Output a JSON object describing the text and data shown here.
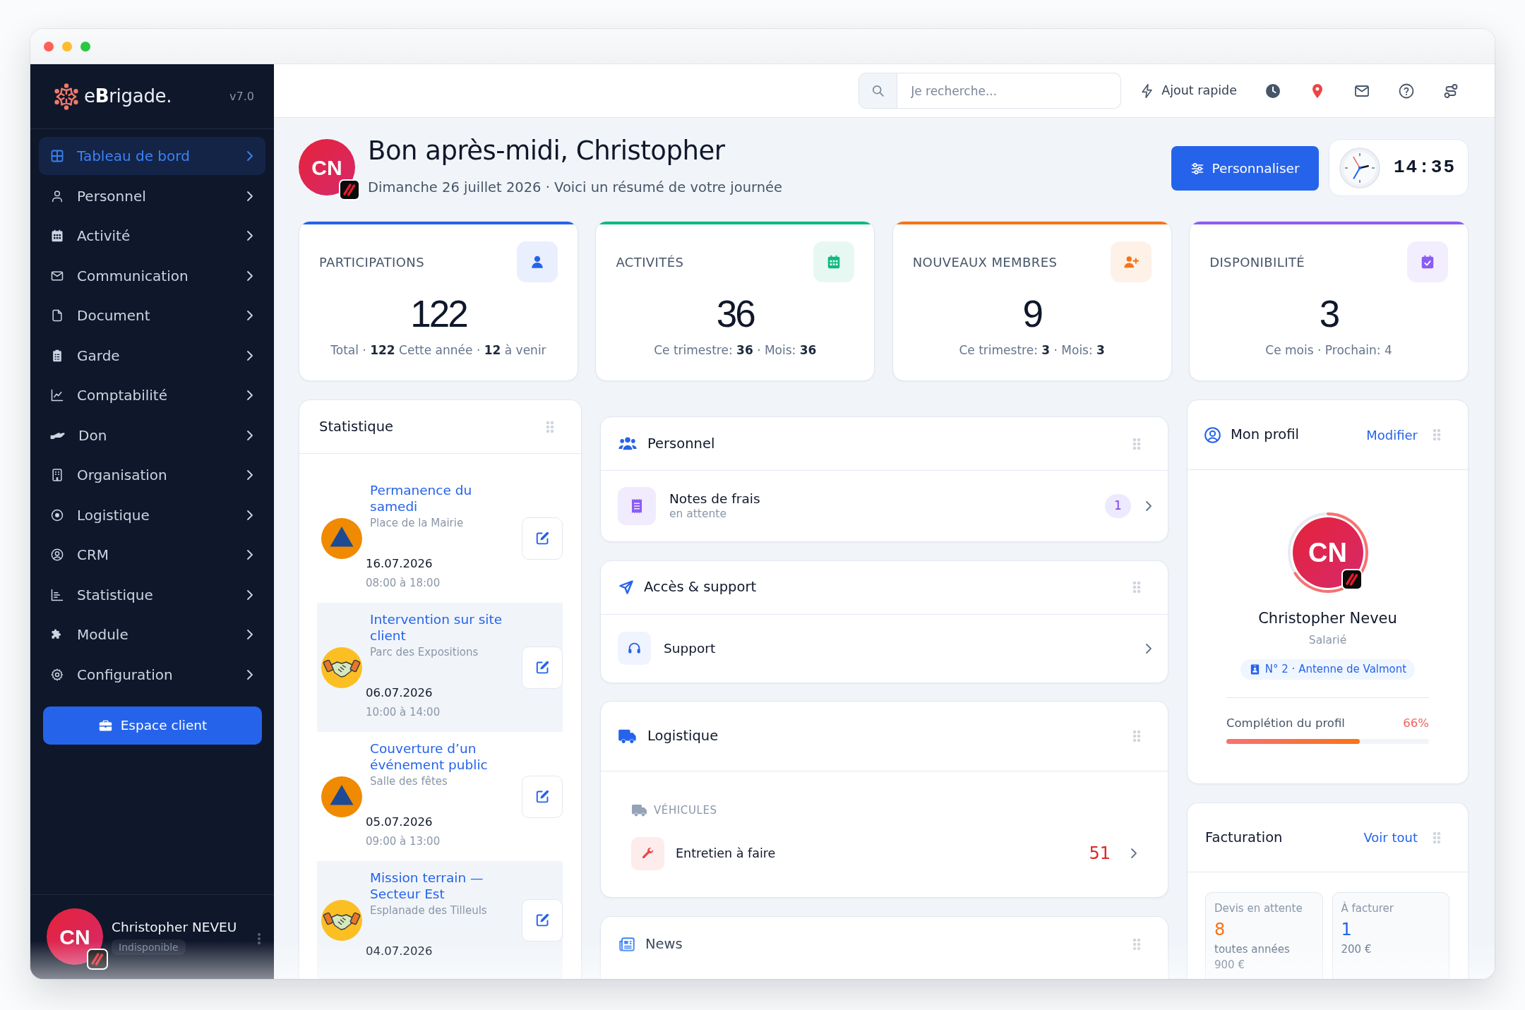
{
  "sidebar": {
    "logo": "e**B**rigade.",
    "version": "v7.0",
    "items": [
      {
        "label": "Tableau de bord",
        "selected": true
      },
      {
        "label": "Personnel",
        "selected": false
      },
      {
        "label": "Activité",
        "selected": false
      },
      {
        "label": "Communication",
        "selected": false
      },
      {
        "label": "Document",
        "selected": false
      },
      {
        "label": "Garde",
        "selected": false
      },
      {
        "label": "Comptabilité",
        "selected": false
      },
      {
        "label": "Don",
        "selected": false
      },
      {
        "label": "Organisation",
        "selected": false
      },
      {
        "label": "Logistique",
        "selected": false
      },
      {
        "label": "CRM",
        "selected": false
      },
      {
        "label": "Statistique",
        "selected": false
      },
      {
        "label": "Module",
        "selected": false
      },
      {
        "label": "Configuration",
        "selected": false
      }
    ],
    "client_button": "Espace client",
    "user": {
      "initials": "CN",
      "name": "Christopher NEVEU",
      "status": "Indisponible"
    }
  },
  "topbar": {
    "search": {
      "placeholder": "Je recherche..."
    },
    "quick_add": "Ajout rapide"
  },
  "greeting": {
    "initials": "CN",
    "title": "Bon après-midi, Christopher",
    "subtitle": "Dimanche 26 juillet 2026 · Voici un résumé de votre journée",
    "customize_button": "Personnaliser",
    "time": "14:35"
  },
  "stats": [
    {
      "label": "PARTICIPATIONS",
      "value": "122",
      "detail": "Total · **122** Cette année · **12** à venir",
      "color": "#2563eb"
    },
    {
      "label": "ACTIVITÉS",
      "value": "36",
      "detail": "Ce trimestre: **36** · Mois: **36**",
      "color": "#10b981"
    },
    {
      "label": "NOUVEAUX MEMBRES",
      "value": "9",
      "detail": "Ce trimestre: **3** · Mois: **3**",
      "color": "#f97316"
    },
    {
      "label": "DISPONIBILITÉ",
      "value": "3",
      "detail": "Ce mois · Prochain: 4",
      "color": "#8b5cf6"
    }
  ],
  "statistics_panel": {
    "title": "Statistique",
    "events": [
      {
        "title": "Permanence du samedi",
        "place": "Place de la Mairie",
        "date": "16.07.2026",
        "time": "08:00 à 18:00"
      },
      {
        "title": "Intervention sur site client",
        "place": "Parc des Expositions",
        "date": "06.07.2026",
        "time": "10:00 à 14:00"
      },
      {
        "title": "Couverture d’un événement public",
        "place": "Salle des fêtes",
        "date": "05.07.2026",
        "time": "09:00 à 13:00"
      },
      {
        "title": "Mission terrain — Secteur Est",
        "place": "Esplanade des Tilleuls",
        "date": "04.07.2026"
      }
    ]
  },
  "personnel_card": {
    "title": "Personnel",
    "row": {
      "label": "Notes de frais",
      "sublabel": "en attente",
      "count": "1"
    }
  },
  "access_card": {
    "title": "Accès & support",
    "row": {
      "label": "Support"
    }
  },
  "logistics_card": {
    "title": "Logistique",
    "section": "VÉHICULES",
    "row": {
      "label": "Entretien à faire",
      "count": "51"
    }
  },
  "news_card": {
    "title": "News"
  },
  "profile_card": {
    "title": "Mon profil",
    "action": "Modifier",
    "initials": "CN",
    "name": "Christopher Neveu",
    "role": "Salarié",
    "badge": "N° 2 · Antenne de Valmont",
    "completion_label": "Complétion du profil",
    "completion_value": "66%",
    "level": 0.66
  },
  "billing_card": {
    "title": "Facturation",
    "action": "Voir tout",
    "tiles": [
      {
        "label": "Devis en attente",
        "value": "8",
        "note": "toutes années",
        "amount": "900 €",
        "color": "#f97316"
      },
      {
        "label": "À facturer",
        "value": "1",
        "amount": "200 €",
        "color": "#2563eb"
      }
    ]
  }
}
